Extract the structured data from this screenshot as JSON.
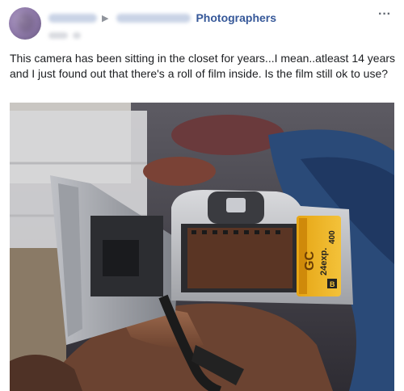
{
  "post": {
    "group_name": "Photographers",
    "group_arrow": "▶",
    "more_icon": "more-horizontal-icon",
    "text": "This camera has been sitting in the closet for years...I mean..atleast 14 years and I just found out that there's a roll of film inside. Is the film still ok to use?",
    "photo": {
      "film_brand_mark": "GC",
      "film_speed": "400",
      "film_exposures": "24exp.",
      "film_badge": "B"
    }
  }
}
